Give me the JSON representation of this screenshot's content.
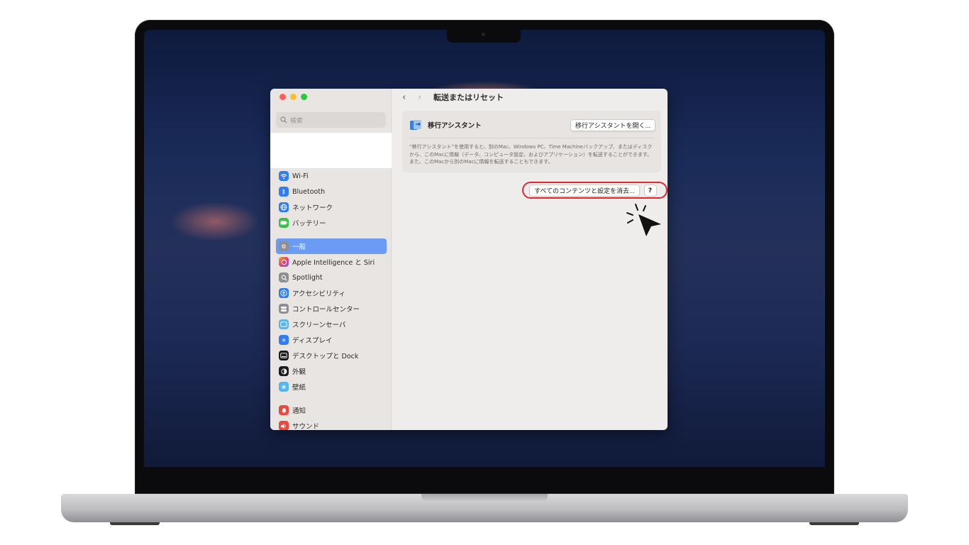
{
  "window": {
    "title": "転送またはリセット",
    "nav_back": "‹",
    "nav_forward": "›"
  },
  "sidebar": {
    "search_placeholder": "検索",
    "items": [
      {
        "label": "Wi-Fi",
        "icon": "wifi-icon",
        "color": "#2f7cf6"
      },
      {
        "label": "Bluetooth",
        "icon": "bluetooth-icon",
        "color": "#2f7cf6"
      },
      {
        "label": "ネットワーク",
        "icon": "globe-icon",
        "color": "#2f7cf6"
      },
      {
        "label": "バッテリー",
        "icon": "battery-icon",
        "color": "#3cc04a"
      },
      {
        "label": "一般",
        "icon": "gear-icon",
        "color": "#8e8e93",
        "active": true
      },
      {
        "label": "Apple Intelligence と Siri",
        "icon": "siri-icon",
        "color": "#e8742b"
      },
      {
        "label": "Spotlight",
        "icon": "spotlight-icon",
        "color": "#8e8e93"
      },
      {
        "label": "アクセシビリティ",
        "icon": "accessibility-icon",
        "color": "#2f7cf6"
      },
      {
        "label": "コントロールセンター",
        "icon": "control-center-icon",
        "color": "#8e8e93"
      },
      {
        "label": "スクリーンセーバ",
        "icon": "screensaver-icon",
        "color": "#5ab6e8"
      },
      {
        "label": "ディスプレイ",
        "icon": "display-icon",
        "color": "#2f7cf6"
      },
      {
        "label": "デスクトップと Dock",
        "icon": "dock-icon",
        "color": "#1c1c1e"
      },
      {
        "label": "外観",
        "icon": "appearance-icon",
        "color": "#1c1c1e"
      },
      {
        "label": "壁紙",
        "icon": "wallpaper-icon",
        "color": "#52b6f0"
      },
      {
        "label": "通知",
        "icon": "notification-icon",
        "color": "#f0453a"
      },
      {
        "label": "サウンド",
        "icon": "sound-icon",
        "color": "#f0453a"
      }
    ]
  },
  "main": {
    "migration": {
      "label": "移行アシスタント",
      "open_button": "移行アシスタントを開く...",
      "description": "“移行アシスタント”を使用すると、別のMac、Windows PC、Time Machineバックアップ、またはディスクから、このMacに情報（データ、コンピュータ設定、およびアプリケーション）を転送することができます。また、このMacから別のMacに情報を転送することもできます。"
    },
    "erase_button": "すべてのコンテンツと設定を消去...",
    "help_button": "?"
  },
  "colors": {
    "accent": "#6a9cf5",
    "highlight": "#e6252c"
  }
}
